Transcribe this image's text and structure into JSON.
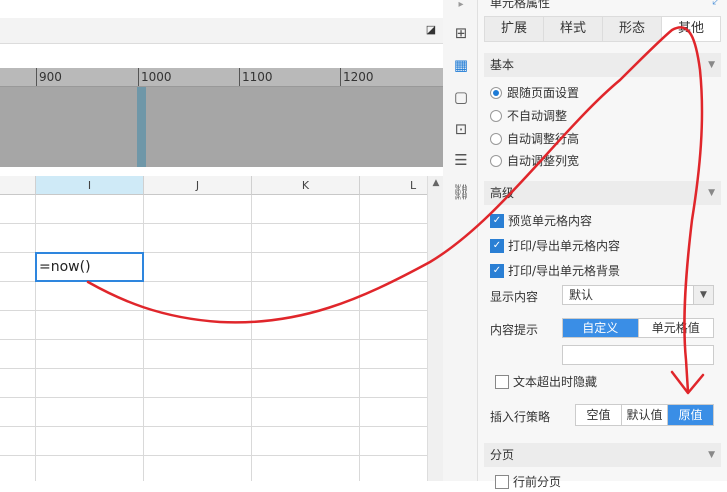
{
  "ruler": {
    "ticks": [
      "900",
      "1000",
      "1100",
      "1200"
    ]
  },
  "grid": {
    "columns": [
      "I",
      "J",
      "K",
      "L"
    ],
    "active_cell_formula": "=now()"
  },
  "panel": {
    "title": "单元格属性",
    "tabs": [
      "扩展",
      "样式",
      "形态",
      "其他"
    ],
    "basic": {
      "heading": "基本",
      "options": [
        "跟随页面设置",
        "不自动调整",
        "自动调整行高",
        "自动调整列宽"
      ],
      "selected_index": 0
    },
    "advanced": {
      "heading": "高级",
      "checks": [
        "预览单元格内容",
        "打印/导出单元格内容",
        "打印/导出单元格背景"
      ],
      "display_label": "显示内容",
      "display_value": "默认",
      "tooltip_label": "内容提示",
      "tooltip_options": [
        "自定义",
        "单元格值"
      ],
      "hide_overflow_label": "文本超出时隐藏",
      "insert_label": "插入行策略",
      "insert_options": [
        "空值",
        "默认值",
        "原值"
      ],
      "insert_selected": "原值"
    },
    "paging": {
      "heading": "分页",
      "first_item": "行前分页"
    }
  },
  "colors": {
    "accent": "#3a8ee6",
    "annotation": "#e0262b"
  }
}
